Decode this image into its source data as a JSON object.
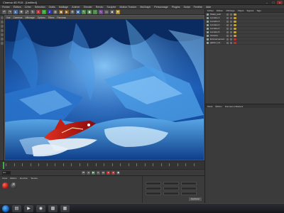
{
  "window": {
    "title": "Cinema 4D R15 - [Untitled]",
    "controls": [
      "–",
      "□",
      "×"
    ]
  },
  "menubar": {
    "items": [
      "Fichier",
      "Édition",
      "Créer",
      "Sélection",
      "Outils",
      "Maillage",
      "Animer",
      "Simuler",
      "Rendu",
      "Sculpter",
      "Motion Tracker",
      "MoGraph",
      "Personnage",
      "Plugins",
      "Script",
      "Fenêtre",
      "Aide"
    ]
  },
  "toolbar": {
    "icons": [
      "undo-icon",
      "redo-icon",
      "select-icon",
      "move-icon",
      "scale-icon",
      "rotate-icon",
      "x-axis-icon",
      "y-axis-icon",
      "z-axis-icon",
      "world-icon",
      "render-view-icon",
      "render-icon",
      "render-settings-icon",
      "cube-icon",
      "pen-icon",
      "subdivide-icon",
      "array-icon",
      "deformer-icon",
      "floor-icon",
      "camera-icon",
      "light-icon"
    ]
  },
  "viewport": {
    "menu": [
      "Vue",
      "Caméras",
      "Affichage",
      "Options",
      "Filtres",
      "Panneau"
    ]
  },
  "object_manager": {
    "tabs": [
      "Fichier",
      "Édition",
      "Affichage",
      "Objets",
      "Signets",
      "Tags"
    ],
    "rows": [
      {
        "name": "Shark_tech",
        "tag_color": "#c8a030"
      },
      {
        "name": "Lumière.1",
        "tag_color": "#c8a030"
      },
      {
        "name": "Lumière.2",
        "tag_color": "#c8a030"
      },
      {
        "name": "Lumière.3",
        "tag_color": "#c8a030"
      },
      {
        "name": "Lumière.4",
        "tag_color": "#c8a030"
      },
      {
        "name": "Lumière.5",
        "tag_color": "#c8a030"
      },
      {
        "name": "Caméra",
        "tag_color": "#c8a030"
      },
      {
        "name": "Environnement",
        "tag_color": "#c03030"
      },
      {
        "name": "glacier_ice",
        "tag_color": "#c03030"
      }
    ]
  },
  "attributes": {
    "tabs": [
      "Mode",
      "Édition",
      "Données utilisateur"
    ]
  },
  "transport": {
    "current_frame": "0 F"
  },
  "materials": {
    "tabs": [
      "Créer",
      "Édition",
      "Fonction",
      "Texture"
    ]
  },
  "coordinates": {
    "apply_label": "Appliquer"
  }
}
